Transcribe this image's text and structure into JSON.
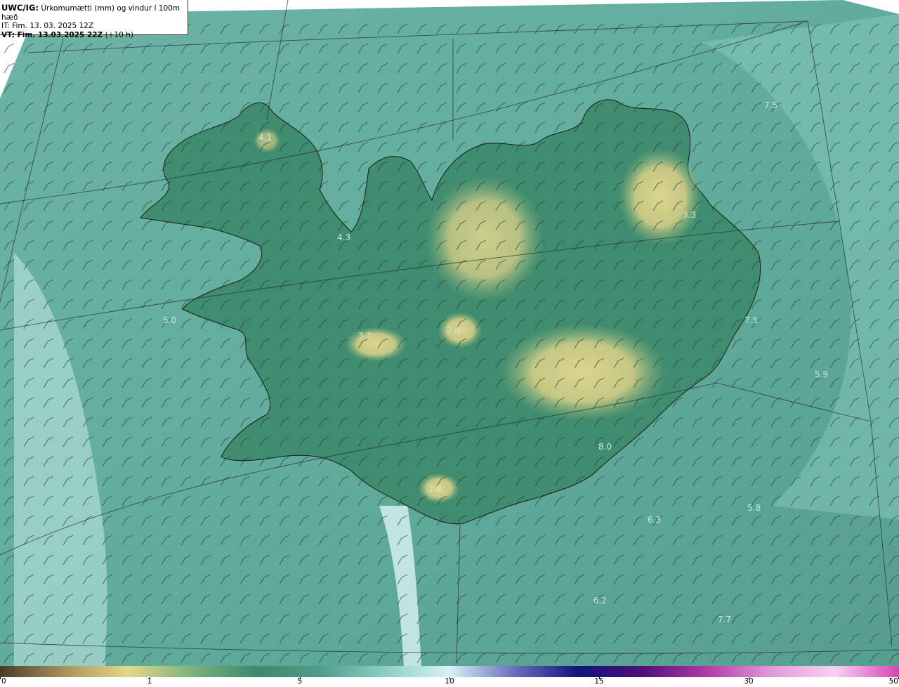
{
  "header": {
    "model": "UWC/IG:",
    "parameter": " Úrkomumætti (mm) og vindur í 100m hæð",
    "init_time": "IT: Fim. 13. 03. 2025 12Z",
    "valid_prefix": "VT: Fim. 13.03.2025 22Z",
    "valid_offset": " (+10 h)"
  },
  "colorbar": {
    "ticks": [
      {
        "label": "0",
        "value": 0
      },
      {
        "label": "1",
        "value": 1
      },
      {
        "label": "5",
        "value": 5
      },
      {
        "label": "10",
        "value": 10
      },
      {
        "label": "15",
        "value": 15
      },
      {
        "label": "30",
        "value": 30
      },
      {
        "label": "50",
        "value": 50
      }
    ],
    "colors": [
      "#4a3a2a",
      "#a8935c",
      "#e4d88a",
      "#7ab07e",
      "#3b8a6c",
      "#4f9e8c",
      "#8ccfc4",
      "#d6f3f4",
      "#6b6fc0",
      "#10147a",
      "#4d0f78",
      "#b03aa8",
      "#e09ad8",
      "#f7d2f0",
      "#d844b8"
    ]
  },
  "labels": [
    {
      "text": "4.1"
    },
    {
      "text": "4.3"
    },
    {
      "text": "3.2"
    },
    {
      "text": "2.4"
    },
    {
      "text": "3.3"
    },
    {
      "text": "7.5"
    },
    {
      "text": "7.5"
    },
    {
      "text": "5.9"
    },
    {
      "text": "5.0"
    },
    {
      "text": "5.8"
    },
    {
      "text": "6.3"
    },
    {
      "text": "6.2"
    },
    {
      "text": "7.7"
    },
    {
      "text": "2.8"
    },
    {
      "text": "8.0"
    }
  ],
  "colors": {
    "sea": "#5aa898",
    "coast": "#1a1a1a",
    "land_dark": "#2f7a5e",
    "land_high": "#d8d38a",
    "label": "#c8e0d4"
  }
}
